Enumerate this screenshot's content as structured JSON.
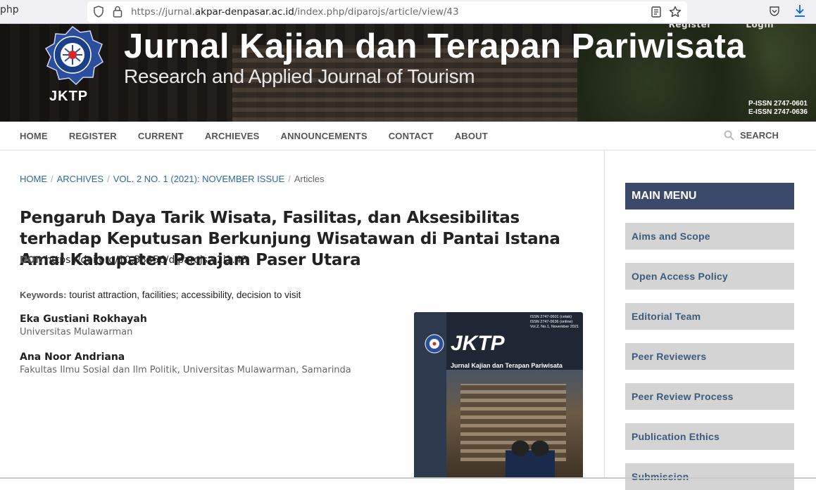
{
  "browser": {
    "url_prefix": "https://jurnal.",
    "url_host": "akpar-denpasar.ac.id",
    "url_path": "/index.php/diparojs/article/view/43",
    "icons": [
      "shield-icon",
      "lock-icon",
      "reader-icon",
      "star-icon",
      "pocket-icon",
      "download-icon"
    ]
  },
  "banner": {
    "top_links": [
      "Register",
      "Login"
    ],
    "title": "Jurnal Kajian dan Terapan Pariwisata",
    "subtitle": "Research and Applied Journal of Tourism",
    "logo_text": "JKTP",
    "issn_print": "P-ISSN 2747-0601",
    "issn_online": "E-ISSN 2747-0636"
  },
  "nav": {
    "items": [
      "HOME",
      "REGISTER",
      "CURRENT",
      "ARCHIEVES",
      "ANNOUNCEMENTS",
      "CONTACT",
      "ABOUT"
    ],
    "search": "SEARCH"
  },
  "breadcrumb": {
    "home": "HOME",
    "archives": "ARCHIVES",
    "issue": "VOL. 2 NO. 1 (2021): NOVEMBER ISSUE",
    "current": "Articles",
    "separator": "/"
  },
  "article": {
    "title": "Pengaruh Daya Tarik Wisata, Fasilitas, dan Aksesibilitas terhadap Keputusan Berkunjung Wisatawan di Pantai Istana Amal Kabupaten Penajam Paser Utara",
    "authors": [
      {
        "name": "Eka Gustiani Rokhayah",
        "affiliation": "Universitas Mulawarman"
      },
      {
        "name": "Ana Noor Andriana",
        "affiliation": "Fakultas Ilmu Sosial dan Ilm Politik, Universitas Mulawarman, Samarinda"
      }
    ],
    "doi_label": "DOI:",
    "doi": "https://doi.org/10.53356/diparojs.v2i1.43",
    "keywords_label": "Keywords:",
    "keywords": "tourist attraction, facilities; accessibility, decision to visit"
  },
  "cover": {
    "name": "JKTP",
    "subtitle": "Jurnal Kajian dan Terapan Pariwisata",
    "issn_lines": [
      "ISSN 2747-0601 (cetak)",
      "ISSN 2747-0636 (online)",
      "Vol.2, No.1, November 2021"
    ]
  },
  "sidebar": {
    "heading": "MAIN MENU",
    "items": [
      "Aims and Scope",
      "Open Access Policy",
      "Editorial Team",
      "Peer Reviewers",
      "Peer Review Process",
      "Publication Ethics",
      "Submission"
    ]
  },
  "colors": {
    "menu_head": "#3b4a6b",
    "link": "#2c6a9e",
    "side_item_bg": "#d4d4d4",
    "side_item_text": "#3b5b7e"
  }
}
